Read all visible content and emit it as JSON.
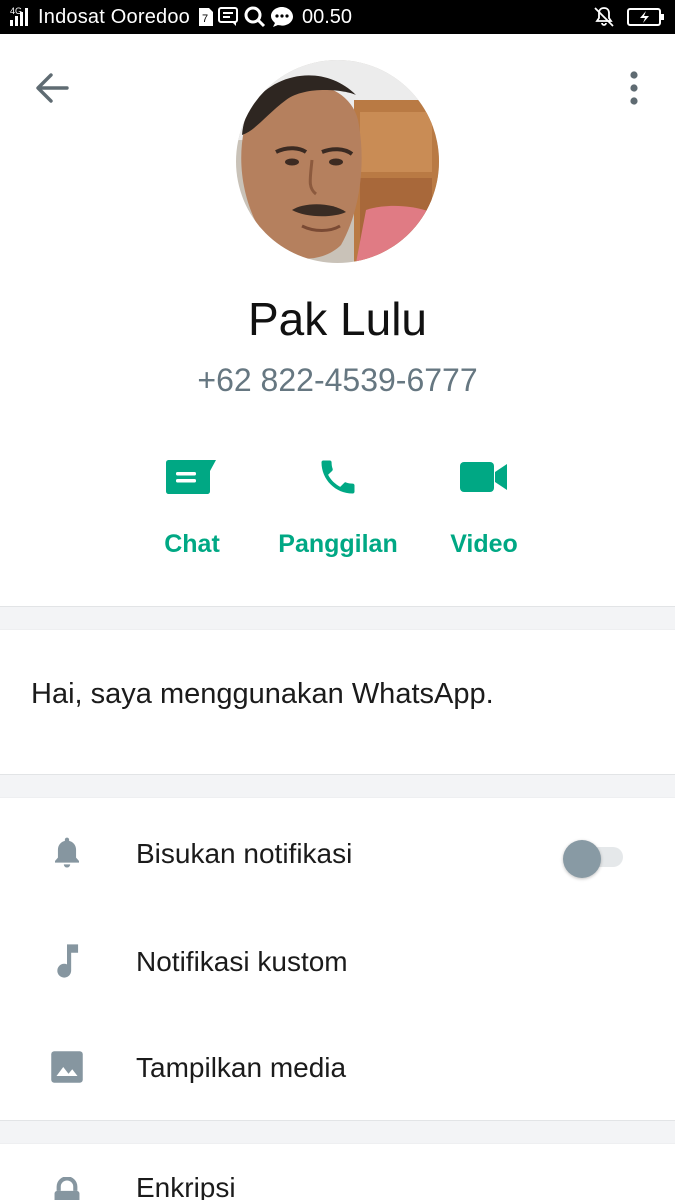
{
  "status_bar": {
    "network": "4G",
    "carrier": "Indosat Ooredoo",
    "time": "00.50"
  },
  "header": {
    "back_icon": "arrow-left-icon",
    "menu_icon": "more-vertical-icon"
  },
  "contact": {
    "name": "Pak Lulu",
    "phone": "+62 822-4539-6777"
  },
  "actions": [
    {
      "label": "Chat",
      "icon": "chat-icon"
    },
    {
      "label": "Panggilan",
      "icon": "phone-icon"
    },
    {
      "label": "Video",
      "icon": "video-camera-icon"
    }
  ],
  "about": {
    "text": "Hai, saya menggunakan WhatsApp."
  },
  "settings": {
    "items": [
      {
        "label": "Bisukan notifikasi",
        "icon": "bell-icon",
        "toggle": false
      },
      {
        "label": "Notifikasi kustom",
        "icon": "music-note-icon"
      },
      {
        "label": "Tampilkan media",
        "icon": "image-icon"
      }
    ]
  },
  "encryption": {
    "label": "Enkripsi",
    "icon": "lock-icon"
  },
  "colors": {
    "accent": "#00a884",
    "icon_gray": "#8696a0",
    "secondary_text": "#667781"
  }
}
